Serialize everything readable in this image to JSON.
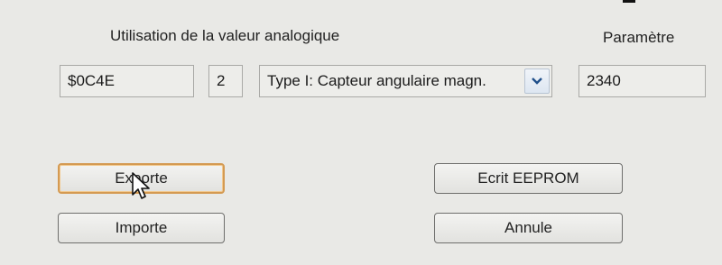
{
  "header": {
    "analog_label": "Utilisation de la valeur  analogique",
    "param_label": "Paramètre"
  },
  "fields": {
    "address": "$0C4E",
    "index": "2",
    "type_selected": "Type I: Capteur angulaire magn.",
    "parameter_value": "2340"
  },
  "buttons": {
    "export": "Exporte",
    "import": "Importe",
    "write_eeprom": "Ecrit EEPROM",
    "cancel": "Annule"
  },
  "icons": {
    "dropdown": "chevron-down-icon",
    "cursor": "mouse-pointer-icon"
  },
  "colors": {
    "window_bg": "#e9e9e6",
    "focus_border": "#d49a52",
    "dropdown_arrow": "#1f4f8a"
  }
}
